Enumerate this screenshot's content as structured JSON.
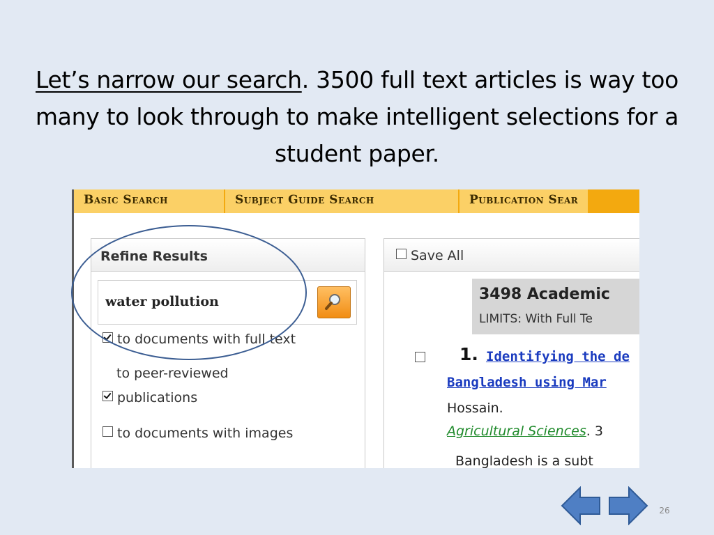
{
  "slide": {
    "title_underlined": "Let’s narrow our search",
    "title_rest": ". 3500 full text articles is way too many to look through to make intelligent selections for a student paper.",
    "slide_number": "26"
  },
  "tabs": [
    "Basic Search",
    "Subject Guide Search",
    "Publication Sear"
  ],
  "refine": {
    "heading": "Refine Results",
    "search_value": "water pollution",
    "limits": {
      "full_text": "to documents with full text",
      "peer_line1": "to peer-reviewed",
      "peer_line2": "publications",
      "images": "to documents with images"
    },
    "checked": {
      "full_text": true,
      "peer_reviewed": true,
      "images": false
    }
  },
  "results": {
    "save_all": "Save All",
    "count_title": "3498 Academic",
    "limits_text": "LIMITS: With Full Te",
    "item": {
      "number": "1.",
      "title_line1": "Identifying the de",
      "title_line2": "Bangladesh using Mar",
      "author": "Hossain.",
      "publication": "Agricultural Sciences",
      "pub_suffix": ". 3",
      "snippet": "Bangladesh is a subt"
    }
  },
  "colors": {
    "slide_bg": "#e2e9f3",
    "tab_bar": "#f3a90f",
    "tab_bg": "#fbd066",
    "link": "#1a3bbf",
    "publication_link": "#1f8a2b",
    "annotation_oval": "#3b5d92",
    "nav_arrow_fill": "#4f7fc4"
  },
  "icons": {
    "search_button": "magnifier-icon",
    "prev": "arrow-left-icon",
    "next": "arrow-right-icon"
  }
}
